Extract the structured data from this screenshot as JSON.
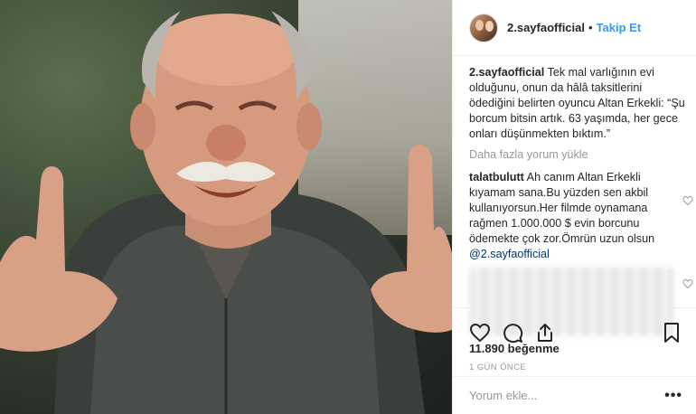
{
  "post": {
    "username": "2.sayfaofficial",
    "separator": "•",
    "follow_label": "Takip Et",
    "caption_user": "2.sayfaofficial",
    "caption_text": " Tek mal varlığının evi olduğunu, onun da hâlâ taksitlerini ödediğini belirten oyuncu Altan Erkekli: “Şu borcum bitsin artık. 63 yaşımda, her gece onları düşünmekten bıktım.”",
    "load_more_label": "Daha fazla yorum yükle",
    "comments": [
      {
        "user": "talatbulutt",
        "text": " Ah canım Altan Erkekli kıyamam sana.Bu yüzden sen akbil kullanıyorsun.Her filmde oynamana rağmen 1.000.000 $ evin borcunu ödemekte çok zor.Ömrün uzun olsun ",
        "mention": "@2.sayfaofficial"
      }
    ],
    "likes_text": "11.890 beğenme",
    "time_text": "1 GÜN ÖNCE",
    "comment_placeholder": "Yorum ekle...",
    "options_label": "•••"
  },
  "icons": {
    "like": "heart-icon",
    "comment": "comment-icon",
    "share": "share-icon",
    "save": "bookmark-icon",
    "comment_like": "heart-icon"
  },
  "colors": {
    "link": "#3897f0",
    "mention": "#003569",
    "text": "#262626",
    "muted": "#999999",
    "border": "#efefef"
  }
}
